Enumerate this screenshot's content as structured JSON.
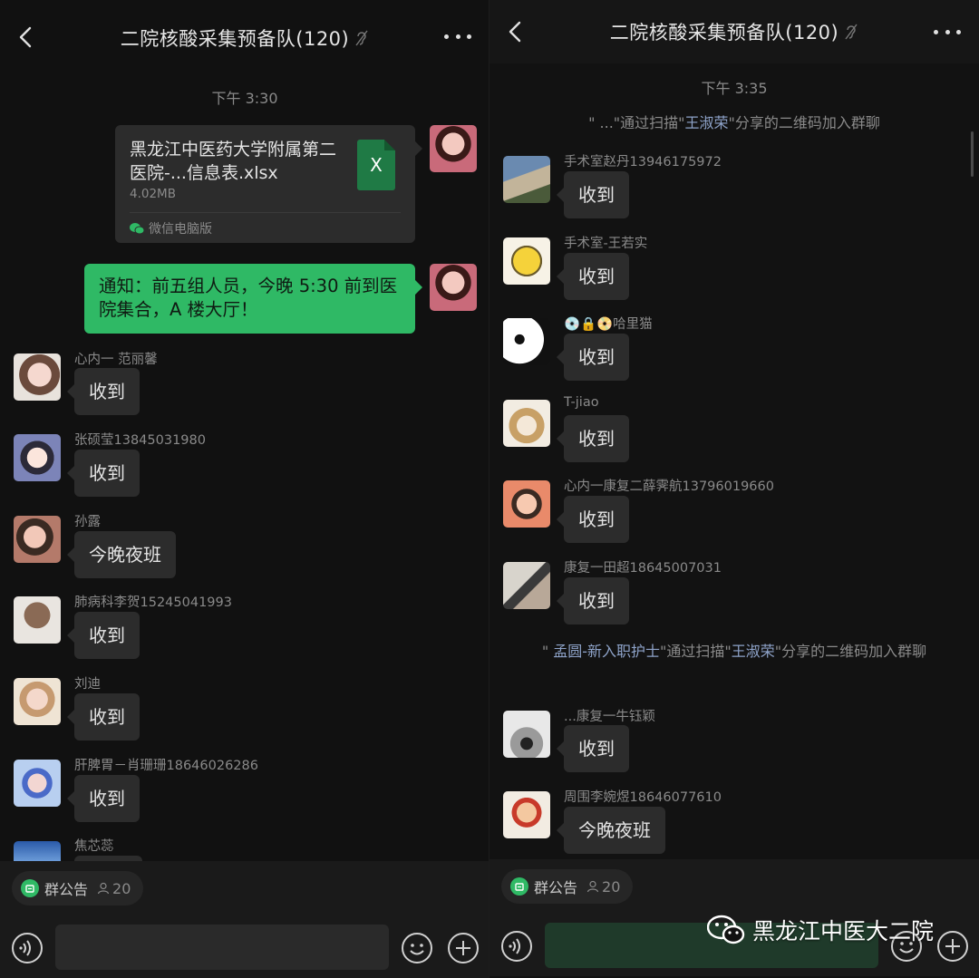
{
  "left": {
    "header": {
      "title": "二院核酸采集预备队(120)"
    },
    "time": "下午 3:30",
    "file": {
      "name": "黑龙江中医药大学附属第二医院-...信息表.xlsx",
      "size": "4.02MB",
      "badge": "X",
      "source": "微信电脑版"
    },
    "notice": "通知：前五组人员，今晚 5:30 前到医院集合，A 楼大厅！",
    "messages": [
      {
        "sender": "心内一  范丽馨",
        "text": "收到"
      },
      {
        "sender": "张硕莹13845031980",
        "text": "收到"
      },
      {
        "sender": "孙露",
        "text": "今晚夜班"
      },
      {
        "sender": "肺病科李贺15245041993",
        "text": "收到"
      },
      {
        "sender": "刘迪",
        "text": "收到"
      },
      {
        "sender": "肝脾胃－肖珊珊18646026286",
        "text": "收到"
      },
      {
        "sender": "焦芯蕊",
        "text": ""
      }
    ],
    "footer": {
      "chip_label": "群公告",
      "chip_count": "20"
    }
  },
  "right": {
    "header": {
      "title": "二院核酸采集预备队(120)"
    },
    "time": "下午 3:35",
    "sys1": {
      "pre": "\" ...\"通过扫描\"",
      "name": "王淑荣",
      "post": "\"分享的二维码加入群聊"
    },
    "sys2": {
      "pre": "\" ",
      "name1": "孟圆-新入职护士",
      "mid": "\"通过扫描\"",
      "name2": "王淑荣",
      "post": "\"分享的二维码加入群聊"
    },
    "messages": [
      {
        "sender": "手术室赵丹13946175972",
        "text": "收到"
      },
      {
        "sender": "手术室-王若实",
        "text": "收到"
      },
      {
        "sender": "💿🔒📀哈里猫",
        "text": "收到"
      },
      {
        "sender": "T-jiao",
        "text": "收到"
      },
      {
        "sender": "心内一康复二薛霁航13796019660",
        "text": "收到"
      },
      {
        "sender": "康复一田超18645007031",
        "text": "收到"
      },
      {
        "sender": "...康复一牛钰颖",
        "text": "收到"
      },
      {
        "sender": "周围李婉煜18646077610",
        "text": "今晚夜班"
      }
    ],
    "footer": {
      "chip_label": "群公告",
      "chip_count": "20"
    }
  },
  "watermark": "黑龙江中医大二院",
  "colors": {
    "accent_green": "#2fb965",
    "bubble_dark": "#2c2c2c",
    "link_blue": "#8ea3c9"
  }
}
